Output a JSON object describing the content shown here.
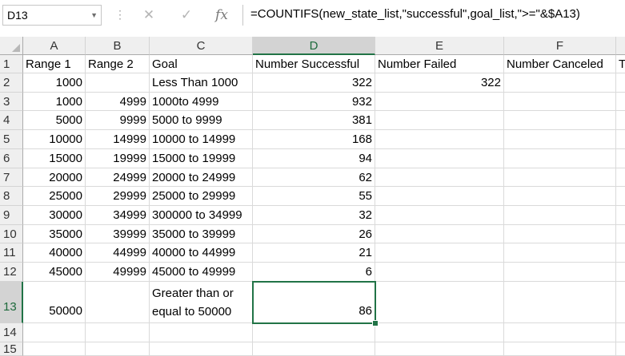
{
  "name_box": {
    "value": "D13",
    "dropdown_icon": "chevron-down-icon"
  },
  "formula_bar": {
    "cancel_icon": "✕",
    "enter_icon": "✓",
    "fx_label": "fx",
    "formula": "=COUNTIFS(new_state_list,\"successful\",goal_list,\">=\"&$A13)"
  },
  "columns": [
    "A",
    "B",
    "C",
    "D",
    "E",
    "F",
    ""
  ],
  "row_numbers": [
    "1",
    "2",
    "3",
    "4",
    "5",
    "6",
    "7",
    "8",
    "9",
    "10",
    "11",
    "12",
    "13",
    "14",
    "15"
  ],
  "headers": {
    "range1": "Range 1",
    "range2": "Range 2",
    "goal": "Goal",
    "successful": "Number Successful",
    "failed": "Number Failed",
    "canceled": "Number Canceled",
    "g_partial": "T"
  },
  "rows": [
    {
      "a": "1000",
      "b": "",
      "c": "Less Than 1000",
      "d": "322",
      "e": "322"
    },
    {
      "a": "1000",
      "b": "4999",
      "c": "1000to 4999",
      "d": "932",
      "e": ""
    },
    {
      "a": "5000",
      "b": "9999",
      "c": "5000 to 9999",
      "d": "381",
      "e": ""
    },
    {
      "a": "10000",
      "b": "14999",
      "c": "10000 to 14999",
      "d": "168",
      "e": ""
    },
    {
      "a": "15000",
      "b": "19999",
      "c": "15000 to 19999",
      "d": "94",
      "e": ""
    },
    {
      "a": "20000",
      "b": "24999",
      "c": "20000 to 24999",
      "d": "62",
      "e": ""
    },
    {
      "a": "25000",
      "b": "29999",
      "c": "25000 to 29999",
      "d": "55",
      "e": ""
    },
    {
      "a": "30000",
      "b": "34999",
      "c": "300000 to 34999",
      "d": "32",
      "e": ""
    },
    {
      "a": "35000",
      "b": "39999",
      "c": "35000 to 39999",
      "d": "26",
      "e": ""
    },
    {
      "a": "40000",
      "b": "44999",
      "c": "40000 to 44999",
      "d": "21",
      "e": ""
    },
    {
      "a": "45000",
      "b": "49999",
      "c": "45000 to 49999",
      "d": "6",
      "e": ""
    },
    {
      "a": "50000",
      "b": "",
      "c": "Greater than or equal to 50000",
      "d": "86",
      "e": ""
    }
  ],
  "accent_color": "#217346"
}
